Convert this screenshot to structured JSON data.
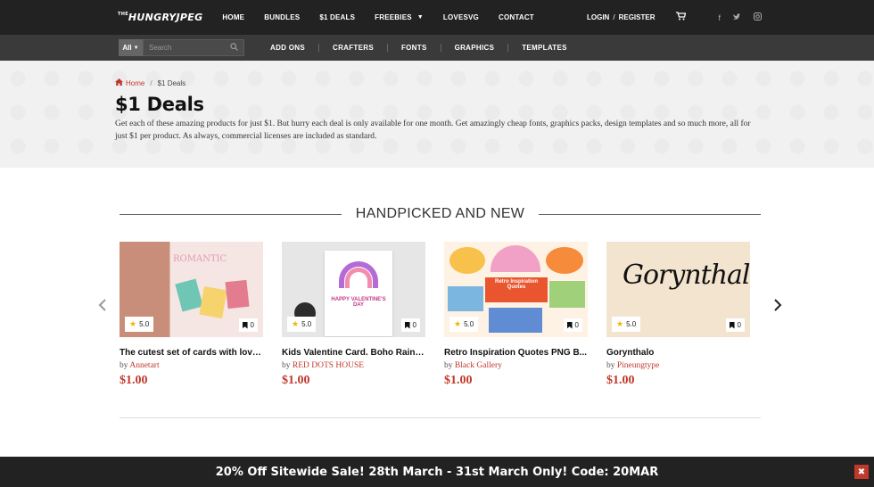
{
  "topbar": {
    "logo_small": "THE",
    "logo": "HUNGRYJPEG",
    "nav": [
      {
        "label": "HOME"
      },
      {
        "label": "BUNDLES"
      },
      {
        "label": "$1 DEALS"
      },
      {
        "label": "FREEBIES"
      },
      {
        "label": "LOVESVG"
      },
      {
        "label": "CONTACT"
      }
    ],
    "login": "LOGIN",
    "separator": "/",
    "register": "REGISTER"
  },
  "subbar": {
    "select_value": "All",
    "search_placeholder": "Search",
    "categories": [
      "ADD ONS",
      "CRAFTERS",
      "FONTS",
      "GRAPHICS",
      "TEMPLATES"
    ]
  },
  "hero": {
    "breadcrumb_home": "Home",
    "breadcrumb_sep": "/",
    "breadcrumb_current": "$1 Deals",
    "title": "$1 Deals",
    "description": "Get each of these amazing products for just $1. But hurry each deal is only available for one month. Get amazingly cheap fonts, graphics packs, design templates and so much more, all for just $1 per product. As always, commercial licenses are included as standard."
  },
  "section": {
    "title": "HANDPICKED AND NEW"
  },
  "products": [
    {
      "name": "The cutest set of cards with love l...",
      "by": "by",
      "author": "Annetart",
      "price": "$1.00",
      "rating": "5.0",
      "saves": "0",
      "thumb_text": "ROMANTIC"
    },
    {
      "name": "Kids Valentine Card. Boho Rainb...",
      "by": "by",
      "author": "RED DOTS HOUSE",
      "price": "$1.00",
      "rating": "5.0",
      "saves": "0",
      "thumb_text": "HAPPY VALENTINE'S DAY"
    },
    {
      "name": "Retro Inspiration Quotes PNG B...",
      "by": "by",
      "author": "Black Gallery",
      "price": "$1.00",
      "rating": "5.0",
      "saves": "0",
      "thumb_text": "Retro Inspiration Quotes"
    },
    {
      "name": "Gorynthalo",
      "by": "by",
      "author": "Pineungtype",
      "price": "$1.00",
      "rating": "5.0",
      "saves": "0",
      "thumb_text": "Gorynthalo"
    }
  ],
  "promo": {
    "text": "20% Off Sitewide Sale! 28th March - 31st March Only! Code: 20MAR",
    "close": "✖"
  },
  "colors": {
    "accent": "#c0392b",
    "topbar": "#222222",
    "subbar": "#3a3a3a"
  }
}
